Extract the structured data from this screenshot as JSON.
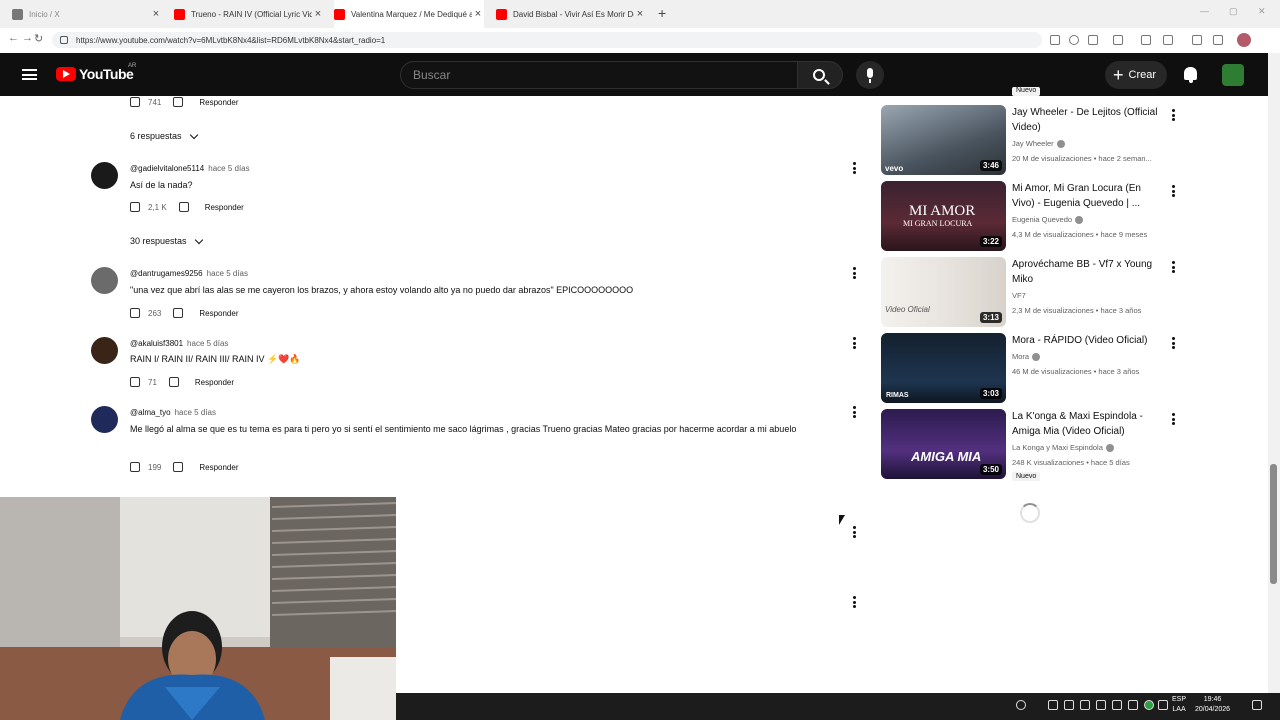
{
  "browser": {
    "tabs": [
      {
        "label": "Inicio / X",
        "icon": "x-logo-icon",
        "color": "#555555",
        "active": false
      },
      {
        "label": "Trueno - RAIN IV (Official Lyric Vid",
        "icon": "youtube-icon",
        "color": "#ff0000",
        "active": false
      },
      {
        "label": "Valentina Marquez / Me Dediqué a",
        "icon": "youtube-icon",
        "color": "#ff0000",
        "active": true
      },
      {
        "label": "David Bisbal - Vivir Así Es Morir De",
        "icon": "youtube-icon",
        "color": "#ff0000",
        "active": false
      }
    ],
    "url": "https://www.youtube.com/watch?v=6MLvtbK8Nx4&list=RD6MLvtbK8Nx4&start_radio=1"
  },
  "youtube": {
    "logo_text": "YouTube",
    "country": "AR",
    "search_placeholder": "Buscar",
    "create_label": "Crear"
  },
  "comments": {
    "top_partial": {
      "likes": "741",
      "reply_label": "Responder"
    },
    "replies_toggle_1": "6 respuestas",
    "items": [
      {
        "author": "@gadielvitalone5114",
        "time": "hace 5 días",
        "text": "Así de la nada?",
        "likes": "2,1 K",
        "reply_label": "Responder"
      },
      {
        "author": "@dantrugames9256",
        "time": "hace 5 días",
        "text": "\"una vez que abrí las alas se me cayeron los brazos, y ahora estoy volando alto ya no puedo dar abrazos\" EPICOOOOOOOO",
        "likes": "263",
        "reply_label": "Responder"
      },
      {
        "author": "@akaluisf3801",
        "time": "hace 5 días",
        "text": "RAIN I/ RAIN II/ RAIN III/ RAIN IV ⚡❤️🔥",
        "likes": "71",
        "reply_label": "Responder"
      },
      {
        "author": "@alma_tyo",
        "time": "hace 5 días",
        "text": "Me llegó al alma se que es tu tema es para ti pero yo si sentí el sentimiento me saco lágrimas , gracias Trueno gracias Mateo gracias por hacerme acordar a mi abuelo",
        "likes": "199",
        "reply_label": "Responder"
      }
    ],
    "replies_toggle_2": "30 respuestas"
  },
  "recommendations": {
    "top_badge": "Nuevo",
    "items": [
      {
        "title": "Jay Wheeler - De Lejitos (Official Video)",
        "channel": "Jay Wheeler",
        "meta": "20 M de visualizaciones • hace 2 seman...",
        "duration": "3:46",
        "badge": ""
      },
      {
        "title": "Mi Amor, Mi Gran Locura (En Vivo) - Eugenia Quevedo | ...",
        "channel": "Eugenia Quevedo",
        "meta": "4,3 M de visualizaciones • hace 9 meses",
        "duration": "3:22",
        "badge": ""
      },
      {
        "title": "Aprovéchame BB - Vf7 x Young Miko",
        "channel": "VF7",
        "meta": "2,3 M de visualizaciones • hace 3 años",
        "duration": "3:13",
        "badge": ""
      },
      {
        "title": "Mora - RÁPIDO (Video Oficial)",
        "channel": "Mora",
        "meta": "46 M de visualizaciones • hace 3 años",
        "duration": "3:03",
        "badge": ""
      },
      {
        "title": "La K'onga & Maxi Espindola - Amiga Mia (Video Oficial)",
        "channel": "La Konga y Maxi Espindola",
        "meta": "248 K visualizaciones • hace 5 días",
        "duration": "3:50",
        "badge": "Nuevo"
      }
    ]
  },
  "thumb_texts": {
    "t1": "vevo",
    "t2": "MI AMOR",
    "t2b": "MI GRAN LOCURA",
    "t3": "Video Oficial",
    "t4": "RIMAS",
    "t5": "AMIGA MIA"
  },
  "taskbar": {
    "lang_line1": "ESP",
    "lang_line2": "LAA",
    "time": "19:46",
    "date": "20/04/2026"
  }
}
